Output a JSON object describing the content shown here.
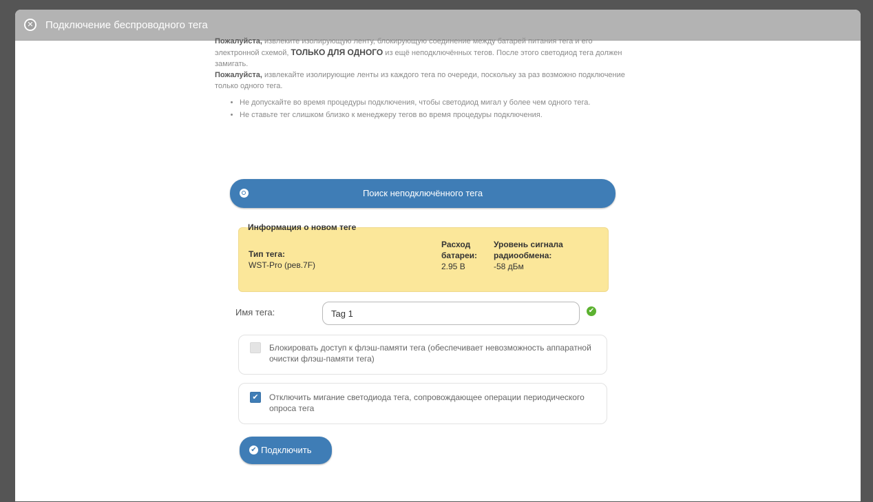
{
  "dialog": {
    "title": "Подключение беспроводного тега",
    "close_glyph": "✕"
  },
  "intro": {
    "p1_bold": "Пожалуйста,",
    "p1_text": " извлеките изолирующую ленту, блокирующую соединение между батарей питания тега и его электронной схемой, ",
    "p1_caps": "ТОЛЬКО ДЛЯ ОДНОГО",
    "p1_text2": " из ещё неподключённых тегов. После этого светодиод тега должен замигать.",
    "p2_bold": "Пожалуйста,",
    "p2_text": " извлекайте изолирующие ленты из каждого тега по очереди, поскольку за раз возможно подключение только одного тега."
  },
  "bullets": [
    "Не допускайте во время процедуры подключения, чтобы светодиод мигал у более чем одного тега.",
    "Не ставьте тег слишком близко к менеджеру тегов во время процедуры подключения."
  ],
  "search_button": {
    "label": "Поиск неподключённого тега",
    "icon": "search-icon"
  },
  "tag_info": {
    "legend": "Информация о новом теге",
    "type_label": "Тип тега:",
    "type_value": "WST-Pro (рев.7F)",
    "battery_label_1": "Расход",
    "battery_label_2": "батареи:",
    "battery_value": "2.95 В",
    "signal_label_1": "Уровень сигнала",
    "signal_label_2": "радиообмена:",
    "signal_value": "-58 дБм"
  },
  "tag_name": {
    "label": "Имя тега:",
    "value": "Tag 1",
    "valid_glyph": "✔"
  },
  "options": [
    {
      "text": "Блокировать доступ к флэш-памяти тега (обеспечивает невозможность аппаратной очистки флэш-памяти тега)",
      "checked": false
    },
    {
      "text": "Отключить мигание светодиода тега, сопровождающее операции периодического опроса тега",
      "checked": true
    }
  ],
  "check_glyph": "✔",
  "connect_button": {
    "label": "Подключить",
    "glyph": "✔"
  },
  "colors": {
    "accent_blue": "#3f7db6",
    "info_yellow": "#fbe79a",
    "titlebar_gray": "#b3b3b3",
    "valid_green": "#5cb230"
  }
}
